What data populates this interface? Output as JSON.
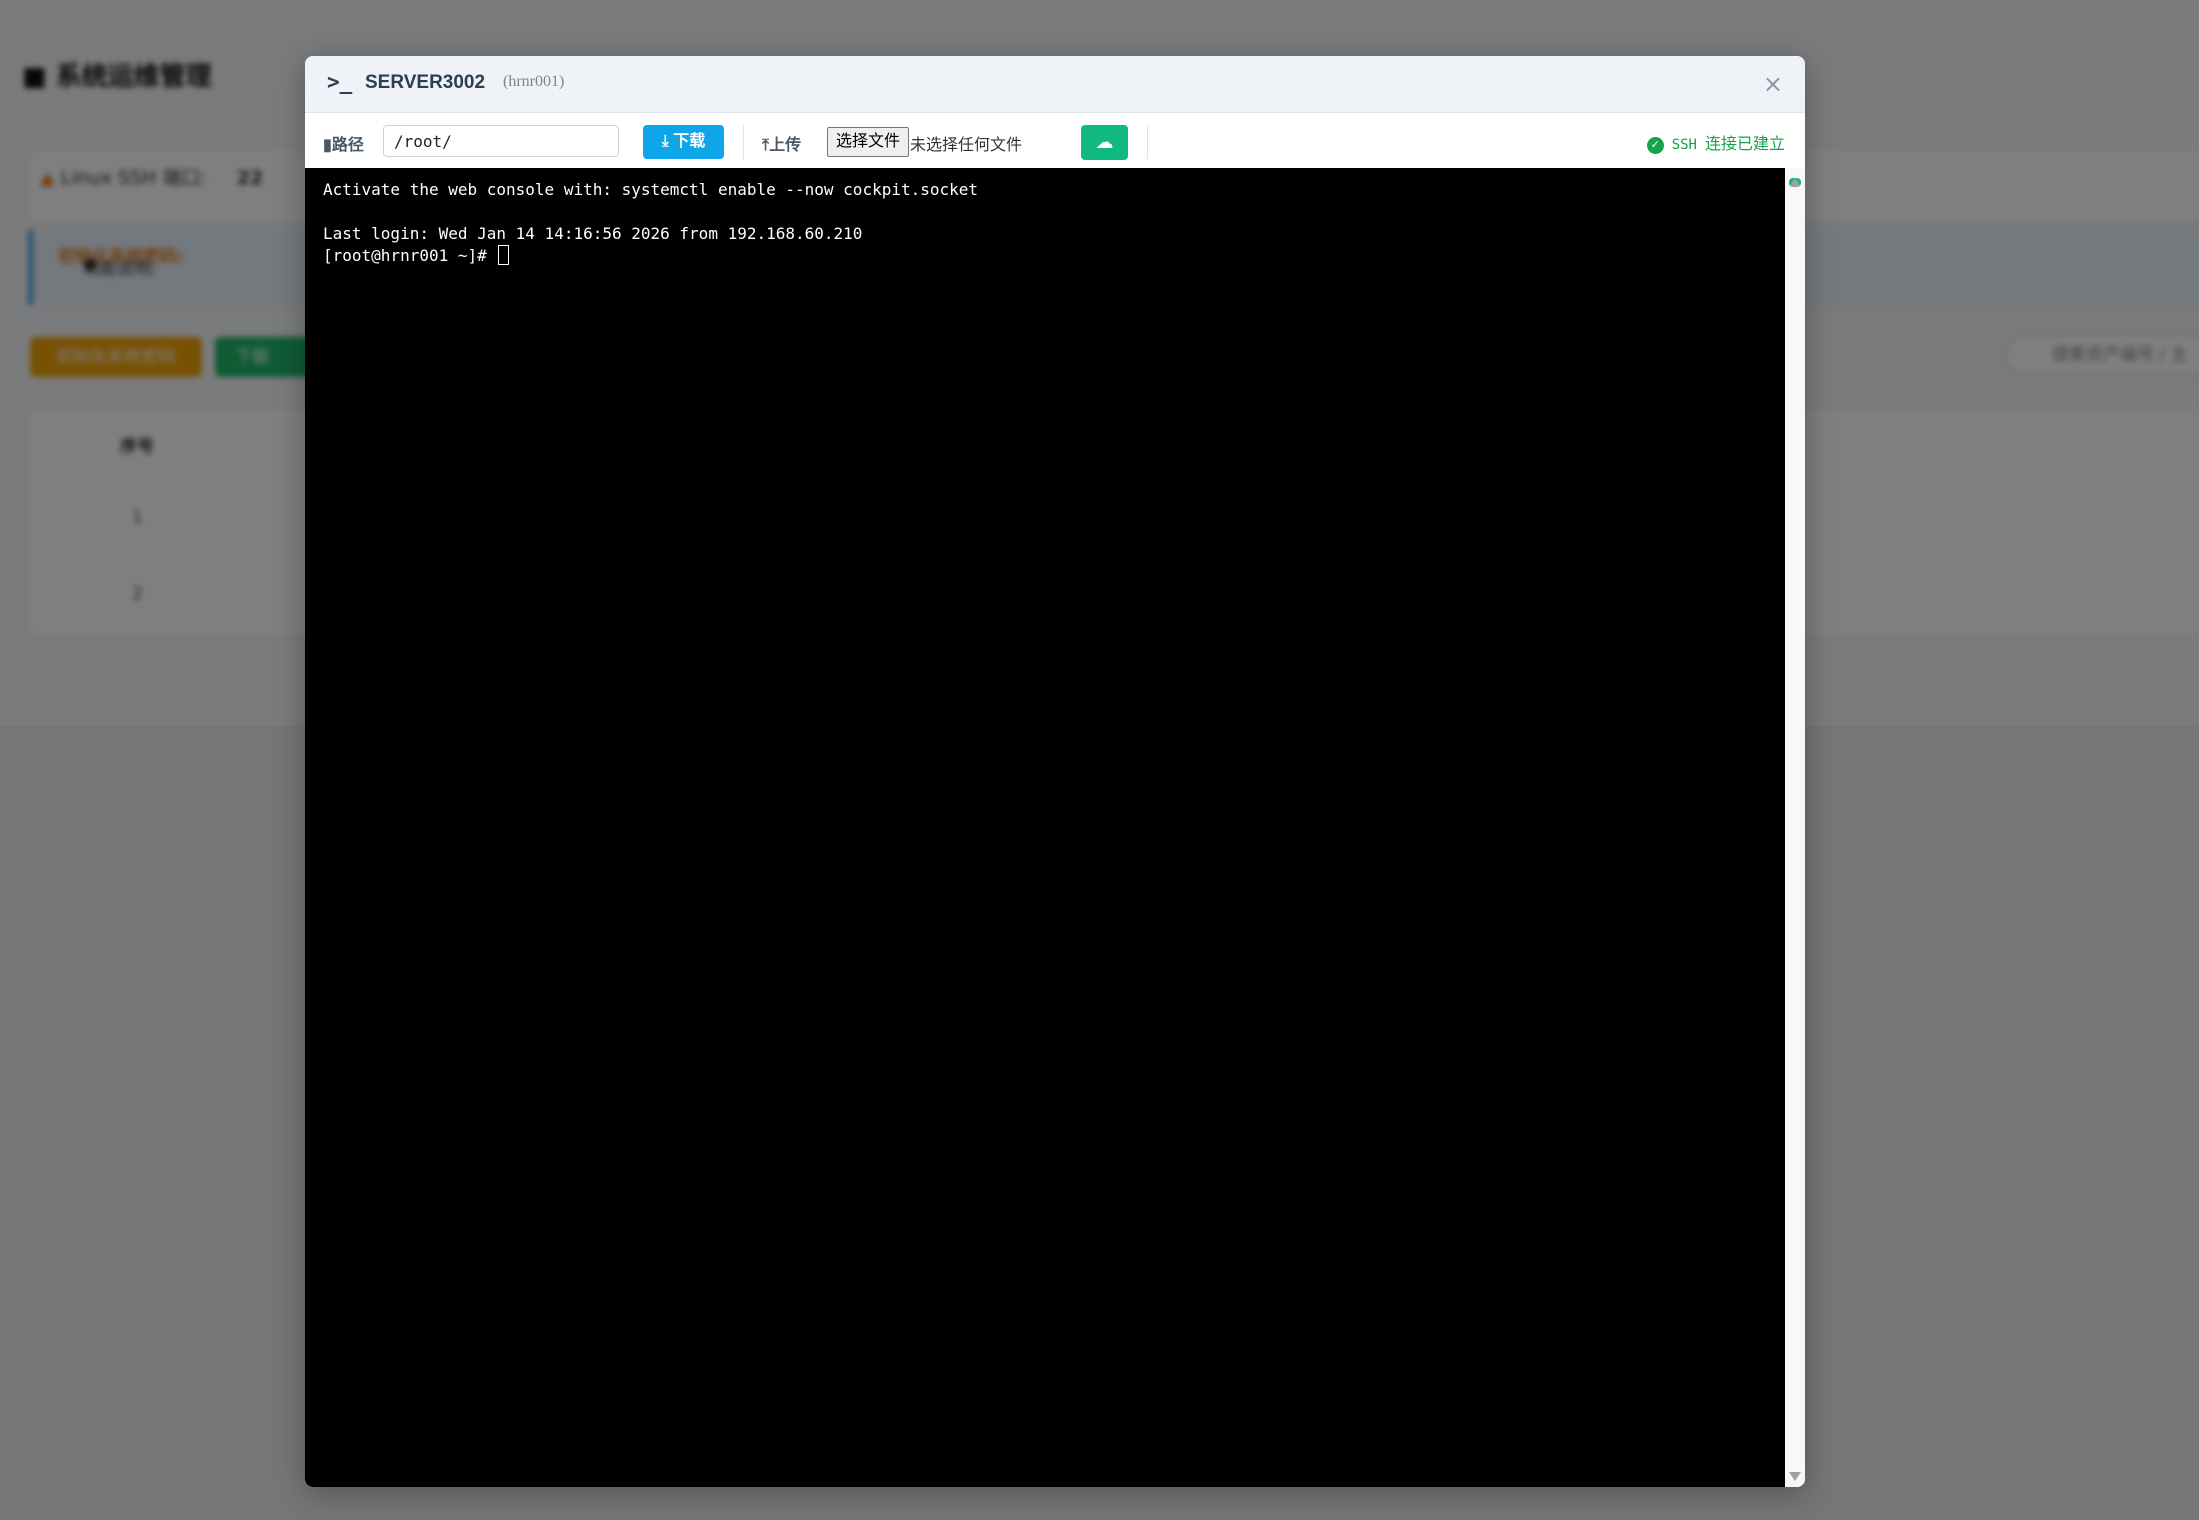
{
  "background": {
    "page_title": "系统运维管理",
    "ssh_port_label": "Linux SSH 端口:",
    "ssh_port_value": "22",
    "info_label": "功能说明:",
    "info_highlight": "初始化系统密码:",
    "init_password_button": "初始化系统密码",
    "download_button": "下载",
    "table_header_index": "序号",
    "rows": [
      "1",
      "2"
    ],
    "search_placeholder": "搜索资产编号 / 主"
  },
  "modal": {
    "title": "SERVER3002",
    "hostname": "(hrnr001)",
    "close_icon": "×",
    "toolbar": {
      "path_label": "路径",
      "path_value": "/root/",
      "download_label": "下载",
      "upload_label": "上传",
      "choose_file_label": "选择文件",
      "no_file_text": "未选择任何文件",
      "status_protocol": "SSH",
      "status_text": "连接已建立",
      "status_color": "#16a34a",
      "download_color": "#0ea5e9",
      "upload_color": "#10b981"
    },
    "terminal": {
      "lines": [
        "Activate the web console with: systemctl enable --now cockpit.socket",
        "",
        "Last login: Wed Jan 14 14:16:56 2026 from 192.168.60.210"
      ],
      "prompt": "[root@hrnr001 ~]# "
    }
  }
}
